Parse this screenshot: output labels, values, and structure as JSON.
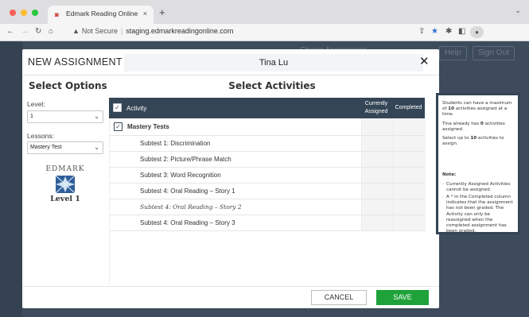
{
  "browser": {
    "tab_title": "Edmark Reading Online",
    "url_warning": "Not Secure",
    "url": "staging.edmarkreadingonline.com",
    "new_tab_symbol": "+",
    "tab_close_symbol": "×"
  },
  "background_page": {
    "button_1": "Help",
    "button_2": "Sign Out",
    "dim_text": "Chang Assignment"
  },
  "modal": {
    "title": "NEW ASSIGNMENT",
    "student_name": "Tina Lu",
    "close_symbol": "✕",
    "select_options": {
      "heading": "Select Options",
      "level_label": "Level:",
      "level_value": "1",
      "lessons_label": "Lessons:",
      "lessons_value": "Mastery Test"
    },
    "logo": {
      "brand": "EDMARK",
      "level": "Level 1"
    },
    "select_activities": {
      "heading": "Select Activities",
      "columns": {
        "activity": "Activity",
        "currently_assigned": "Currently Assigned",
        "completed": "Completed"
      },
      "group": "Mastery Tests",
      "rows": [
        "Subtest 1: Discrimination",
        "Subtest 2: Picture/Phrase Match",
        "Subtest 3: Word Recognition",
        "Subtest 4: Oral Reading – Story 1",
        "Subtest 4: Oral Reading – Story 2",
        "Subtest 4: Oral Reading – Story 3"
      ]
    },
    "buttons": {
      "cancel": "CANCEL",
      "save": "SAVE"
    }
  },
  "info_panel": {
    "p1_pre": "Students can have a maximum of ",
    "p1_num": "10",
    "p1_post": " activities assigned at a time.",
    "p2_pre": "Tina already has ",
    "p2_num": "0",
    "p2_post": " activities assigned.",
    "p3_pre": "Select up to ",
    "p3_num": "10",
    "p3_post": " activities to assign.",
    "note_title": "Note:",
    "note_1": "Currently Assigned Activities cannot be assigned.",
    "note_2": "A * in the Completed column indicates that the assignment has not been graded. The Activity can only be reassigned when the completed assignment has been graded."
  },
  "colors": {
    "header_dark": "#344556",
    "save_green": "#1fa23a",
    "overlay": "#3e4b5c"
  }
}
